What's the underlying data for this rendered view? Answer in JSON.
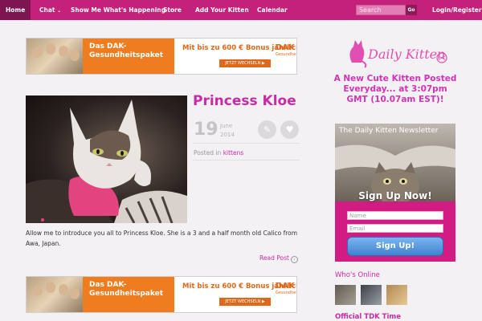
{
  "nav": {
    "items": [
      {
        "label": "Home",
        "active": true
      },
      {
        "label": "Chat",
        "dropdown": true
      },
      {
        "label": "Show Me What's Happening"
      },
      {
        "label": "Store"
      },
      {
        "label": "Add Your Kitten"
      },
      {
        "label": "Calendar"
      }
    ],
    "search_placeholder": "Search",
    "search_button": "Go",
    "login_label": "Login/Register",
    "bar_color": "#c4217a"
  },
  "ads": {
    "orange_line1": "Das DAK-",
    "orange_line2": "Gesundheitspaket",
    "headline": "Mit bis zu 600 € Bonus jährlich!",
    "cta": "JETZT WECHSELN ▶",
    "logo_main": "DAK",
    "logo_sub": "Gesundheit"
  },
  "post": {
    "title": "Princess Kloe",
    "day": "19",
    "month": "June",
    "year": "2014",
    "posted_in_label": "Posted in",
    "category": "kittens",
    "excerpt": "Allow me to introduce you all to Princess Kloe. She is a 3 and a half month old Calico from Awa, Japan.",
    "read_more": "Read Post"
  },
  "sidebar": {
    "logo_text": "Daily Kitten",
    "tagline": "A New Cute Kitten Posted Everyday... at 3:07pm GMT (10.07am EST)!",
    "newsletter": {
      "title": "The Daily Kitten Newsletter",
      "signup": "Sign Up Now!",
      "name_placeholder": "Name",
      "email_placeholder": "Email",
      "button": "Sign Up!"
    },
    "whos_online": "Who's Online",
    "official_time": "Official TDK Time"
  },
  "colors": {
    "accent": "#c82ba6",
    "newsletter_bg": "#d21c83"
  },
  "icons": {
    "search": "search-icon",
    "share": "share-icon",
    "like": "heart-icon",
    "read": "arrow-circle-icon"
  }
}
